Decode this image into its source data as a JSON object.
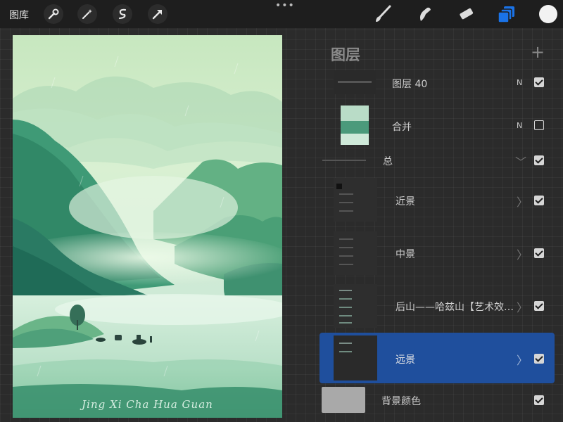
{
  "toolbar": {
    "gallery_label": "图库",
    "more_label": "•••",
    "icons": [
      "wrench-icon",
      "magic-wand-icon",
      "selection-s-icon",
      "arrow-transform-icon",
      "brush-icon",
      "smudge-icon",
      "eraser-icon",
      "layers-icon"
    ],
    "current_color": "#f2f2f2",
    "accent": "#1a73e8"
  },
  "canvas": {
    "signature": "Jing Xi Cha Hua Guan"
  },
  "layers_panel": {
    "title": "图层",
    "add_label": "+",
    "layers": [
      {
        "name": "图层 40",
        "blend": "N",
        "visible": true
      },
      {
        "name": "合并",
        "blend": "N",
        "visible": false
      },
      {
        "name": "总",
        "visible": true,
        "expanded": true
      },
      {
        "name": "近景",
        "visible": true
      },
      {
        "name": "中景",
        "visible": true
      },
      {
        "name": "后山——哈兹山【艺术效…",
        "visible": true
      },
      {
        "name": "远景",
        "visible": true,
        "selected": true
      },
      {
        "name": "背景颜色",
        "visible": true
      }
    ],
    "selected_color": "#1f4f9d"
  }
}
